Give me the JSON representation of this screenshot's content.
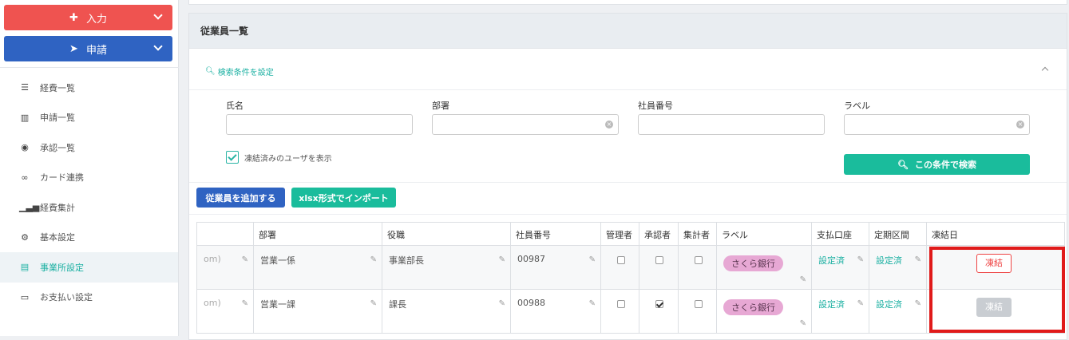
{
  "sidebar": {
    "input_button": "入力",
    "apply_button": "申請",
    "items": [
      {
        "label": "経費一覧",
        "icon": "list-icon"
      },
      {
        "label": "申請一覧",
        "icon": "bar-chart-icon"
      },
      {
        "label": "承認一覧",
        "icon": "check-circle-icon"
      },
      {
        "label": "カード連携",
        "icon": "link-icon"
      },
      {
        "label": "経費集計",
        "icon": "signal-icon"
      },
      {
        "label": "基本設定",
        "icon": "gear-icon"
      },
      {
        "label": "事業所設定",
        "icon": "building-icon",
        "active": true
      },
      {
        "label": "お支払い設定",
        "icon": "credit-card-icon"
      }
    ]
  },
  "panel": {
    "title": "従業員一覧",
    "search_toggle": "検索条件を設定",
    "fields": {
      "name": "氏名",
      "department": "部署",
      "employee_no": "社員番号",
      "label": "ラベル"
    },
    "show_frozen": "凍結済みのユーザを表示",
    "search_button": "この条件で検索",
    "add_button": "従業員を追加する",
    "import_button": "xlsx形式でインポート"
  },
  "table": {
    "headers": [
      "",
      "部署",
      "役職",
      "社員番号",
      "管理者",
      "承認者",
      "集計者",
      "ラベル",
      "支払口座",
      "定期区間",
      "凍結日"
    ],
    "rows": [
      {
        "email_tail": "om)",
        "department": "営業一係",
        "position": "事業部長",
        "employee_no": "00987",
        "admin": false,
        "approver": false,
        "aggregator": false,
        "label": "さくら銀行",
        "account": "設定済",
        "commute": "設定済",
        "freeze_label": "凍結"
      },
      {
        "email_tail": "om)",
        "department": "営業一課",
        "position": "課長",
        "employee_no": "00988",
        "admin": false,
        "approver": true,
        "aggregator": false,
        "label": "さくら銀行",
        "account": "設定済",
        "commute": "設定済",
        "freeze_label": "凍結"
      }
    ]
  },
  "colors": {
    "primary_blue": "#2f63c2",
    "primary_red": "#ef5350",
    "teal": "#1abc9c",
    "highlight_red": "#e01a1a",
    "tag_pink": "#e7a8d4"
  }
}
